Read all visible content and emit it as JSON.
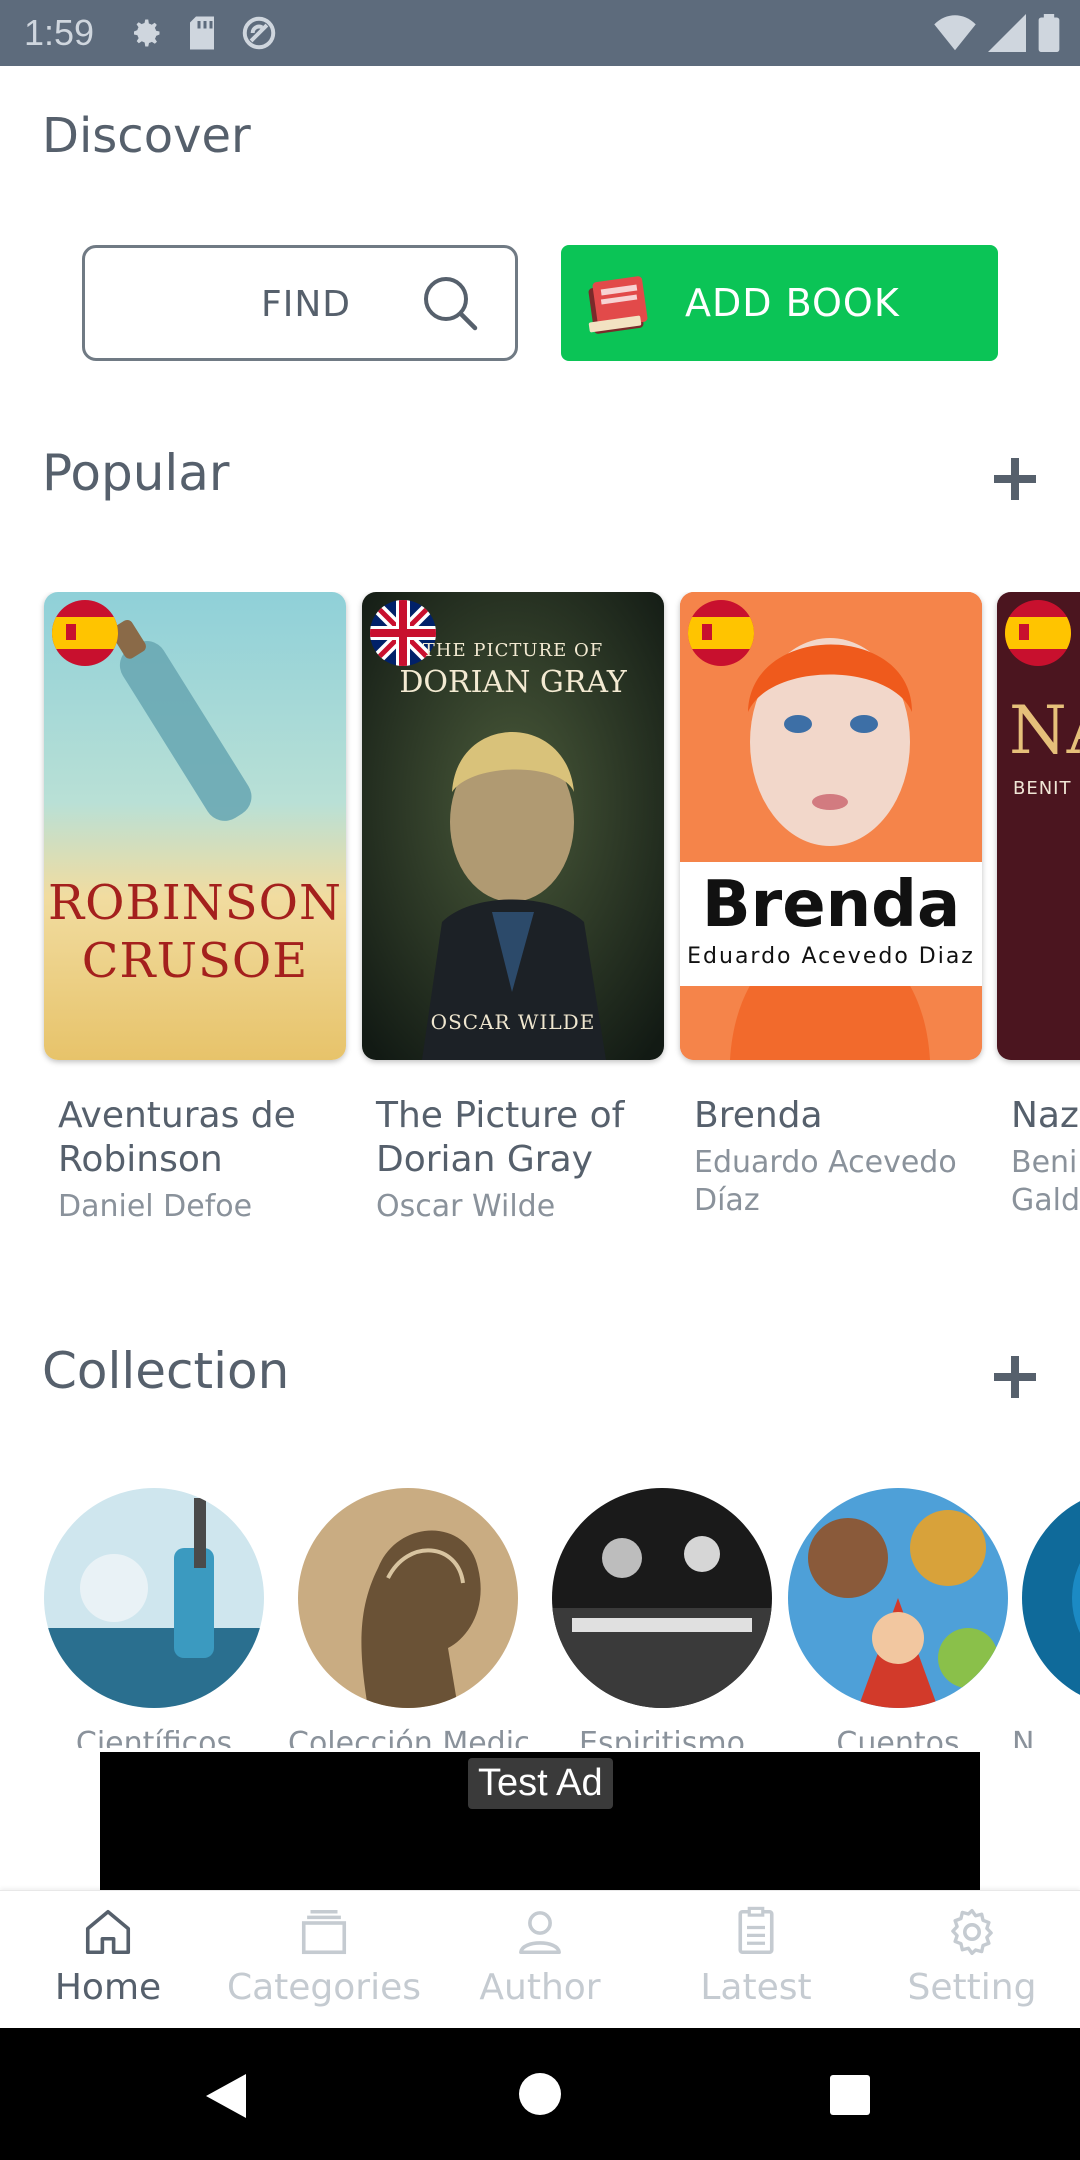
{
  "status_bar": {
    "time": "1:59",
    "left_icons": [
      "gear-icon",
      "sd-card-icon",
      "no-sync-icon"
    ],
    "right_icons": [
      "wifi-icon",
      "signal-icon",
      "battery-icon"
    ]
  },
  "discover": {
    "title": "Discover"
  },
  "find": {
    "label": "FIND"
  },
  "add_book": {
    "label": "ADD BOOK"
  },
  "popular": {
    "title": "Popular",
    "books": [
      {
        "title": "Aventuras de Robinson",
        "author": "Daniel Defoe",
        "flag": "spain",
        "cover_text": [
          "Robinson",
          "Crusoe"
        ]
      },
      {
        "title": "The Picture of Dorian Gray",
        "author": "Oscar Wilde",
        "flag": "uk",
        "cover_text": [
          "The Picture of",
          "Dorian Gray",
          "Oscar Wilde"
        ]
      },
      {
        "title": "Brenda",
        "author": "Eduardo Acevedo Díaz",
        "flag": "spain",
        "cover_text": [
          "Brenda",
          "Eduardo Acevedo Diaz"
        ]
      },
      {
        "title": "Naz",
        "author": "Beni Gald",
        "flag": "spain",
        "cover_text": [
          "NA",
          "BENIT"
        ]
      }
    ]
  },
  "collection": {
    "title": "Collection",
    "items": [
      {
        "label": "Científicos"
      },
      {
        "label": "Colección Medicina"
      },
      {
        "label": "Espiritismo"
      },
      {
        "label": "Cuentos"
      },
      {
        "label": "N"
      }
    ]
  },
  "ad": {
    "label": "Test Ad"
  },
  "bottom_nav": {
    "items": [
      {
        "label": "Home",
        "icon": "home-icon",
        "active": true
      },
      {
        "label": "Categories",
        "icon": "layers-icon",
        "active": false
      },
      {
        "label": "Author",
        "icon": "person-icon",
        "active": false
      },
      {
        "label": "Latest",
        "icon": "document-icon",
        "active": false
      },
      {
        "label": "Setting",
        "icon": "gear-icon",
        "active": false
      }
    ]
  },
  "colors": {
    "accent_green": "#0bc456",
    "text_dark": "#56606c",
    "text_muted": "#8a929b",
    "nav_inactive": "#c5cbd1",
    "status_bar": "#5d6b7c"
  }
}
